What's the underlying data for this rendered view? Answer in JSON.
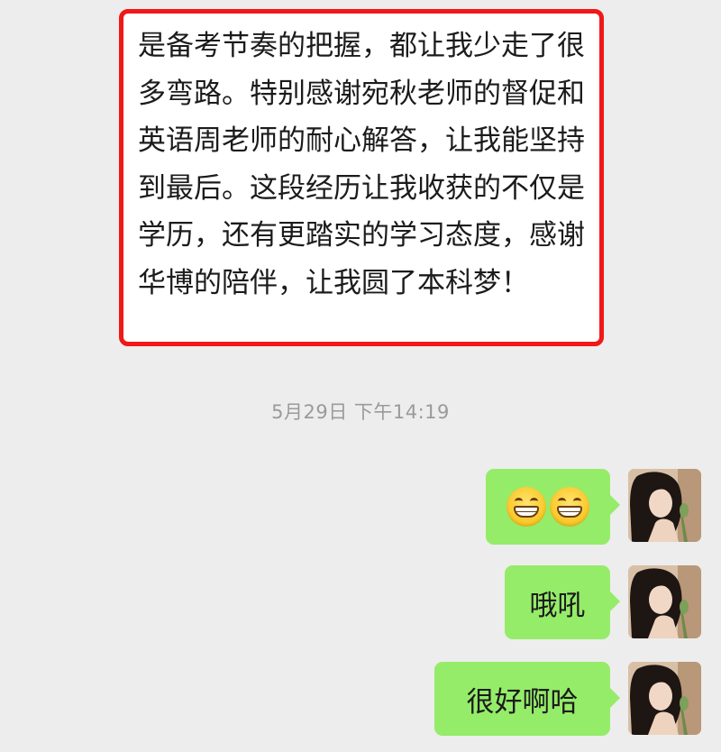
{
  "chat": {
    "incoming_message": "是备考节奏的把握，都让我少走了很多弯路。特别感谢宛秋老师的督促和英语周老师的耐心解答，让我能坚持到最后。这段经历让我收获的不仅是学历，还有更踏实的学习态度，感谢华博的陪伴，让我圆了本科梦！",
    "timestamp": "5月29日 下午14:19",
    "outgoing": [
      {
        "type": "emoji",
        "emoji_icons": [
          "grinning-face-icon",
          "grinning-face-icon"
        ]
      },
      {
        "type": "text",
        "text": "哦吼"
      },
      {
        "type": "text",
        "text": "很好啊哈"
      }
    ]
  },
  "colors": {
    "background": "#ededed",
    "incoming_bubble": "#ffffff",
    "outgoing_bubble": "#95ec69",
    "highlight_border": "#f01818",
    "timestamp_text": "#9a9a9a"
  }
}
